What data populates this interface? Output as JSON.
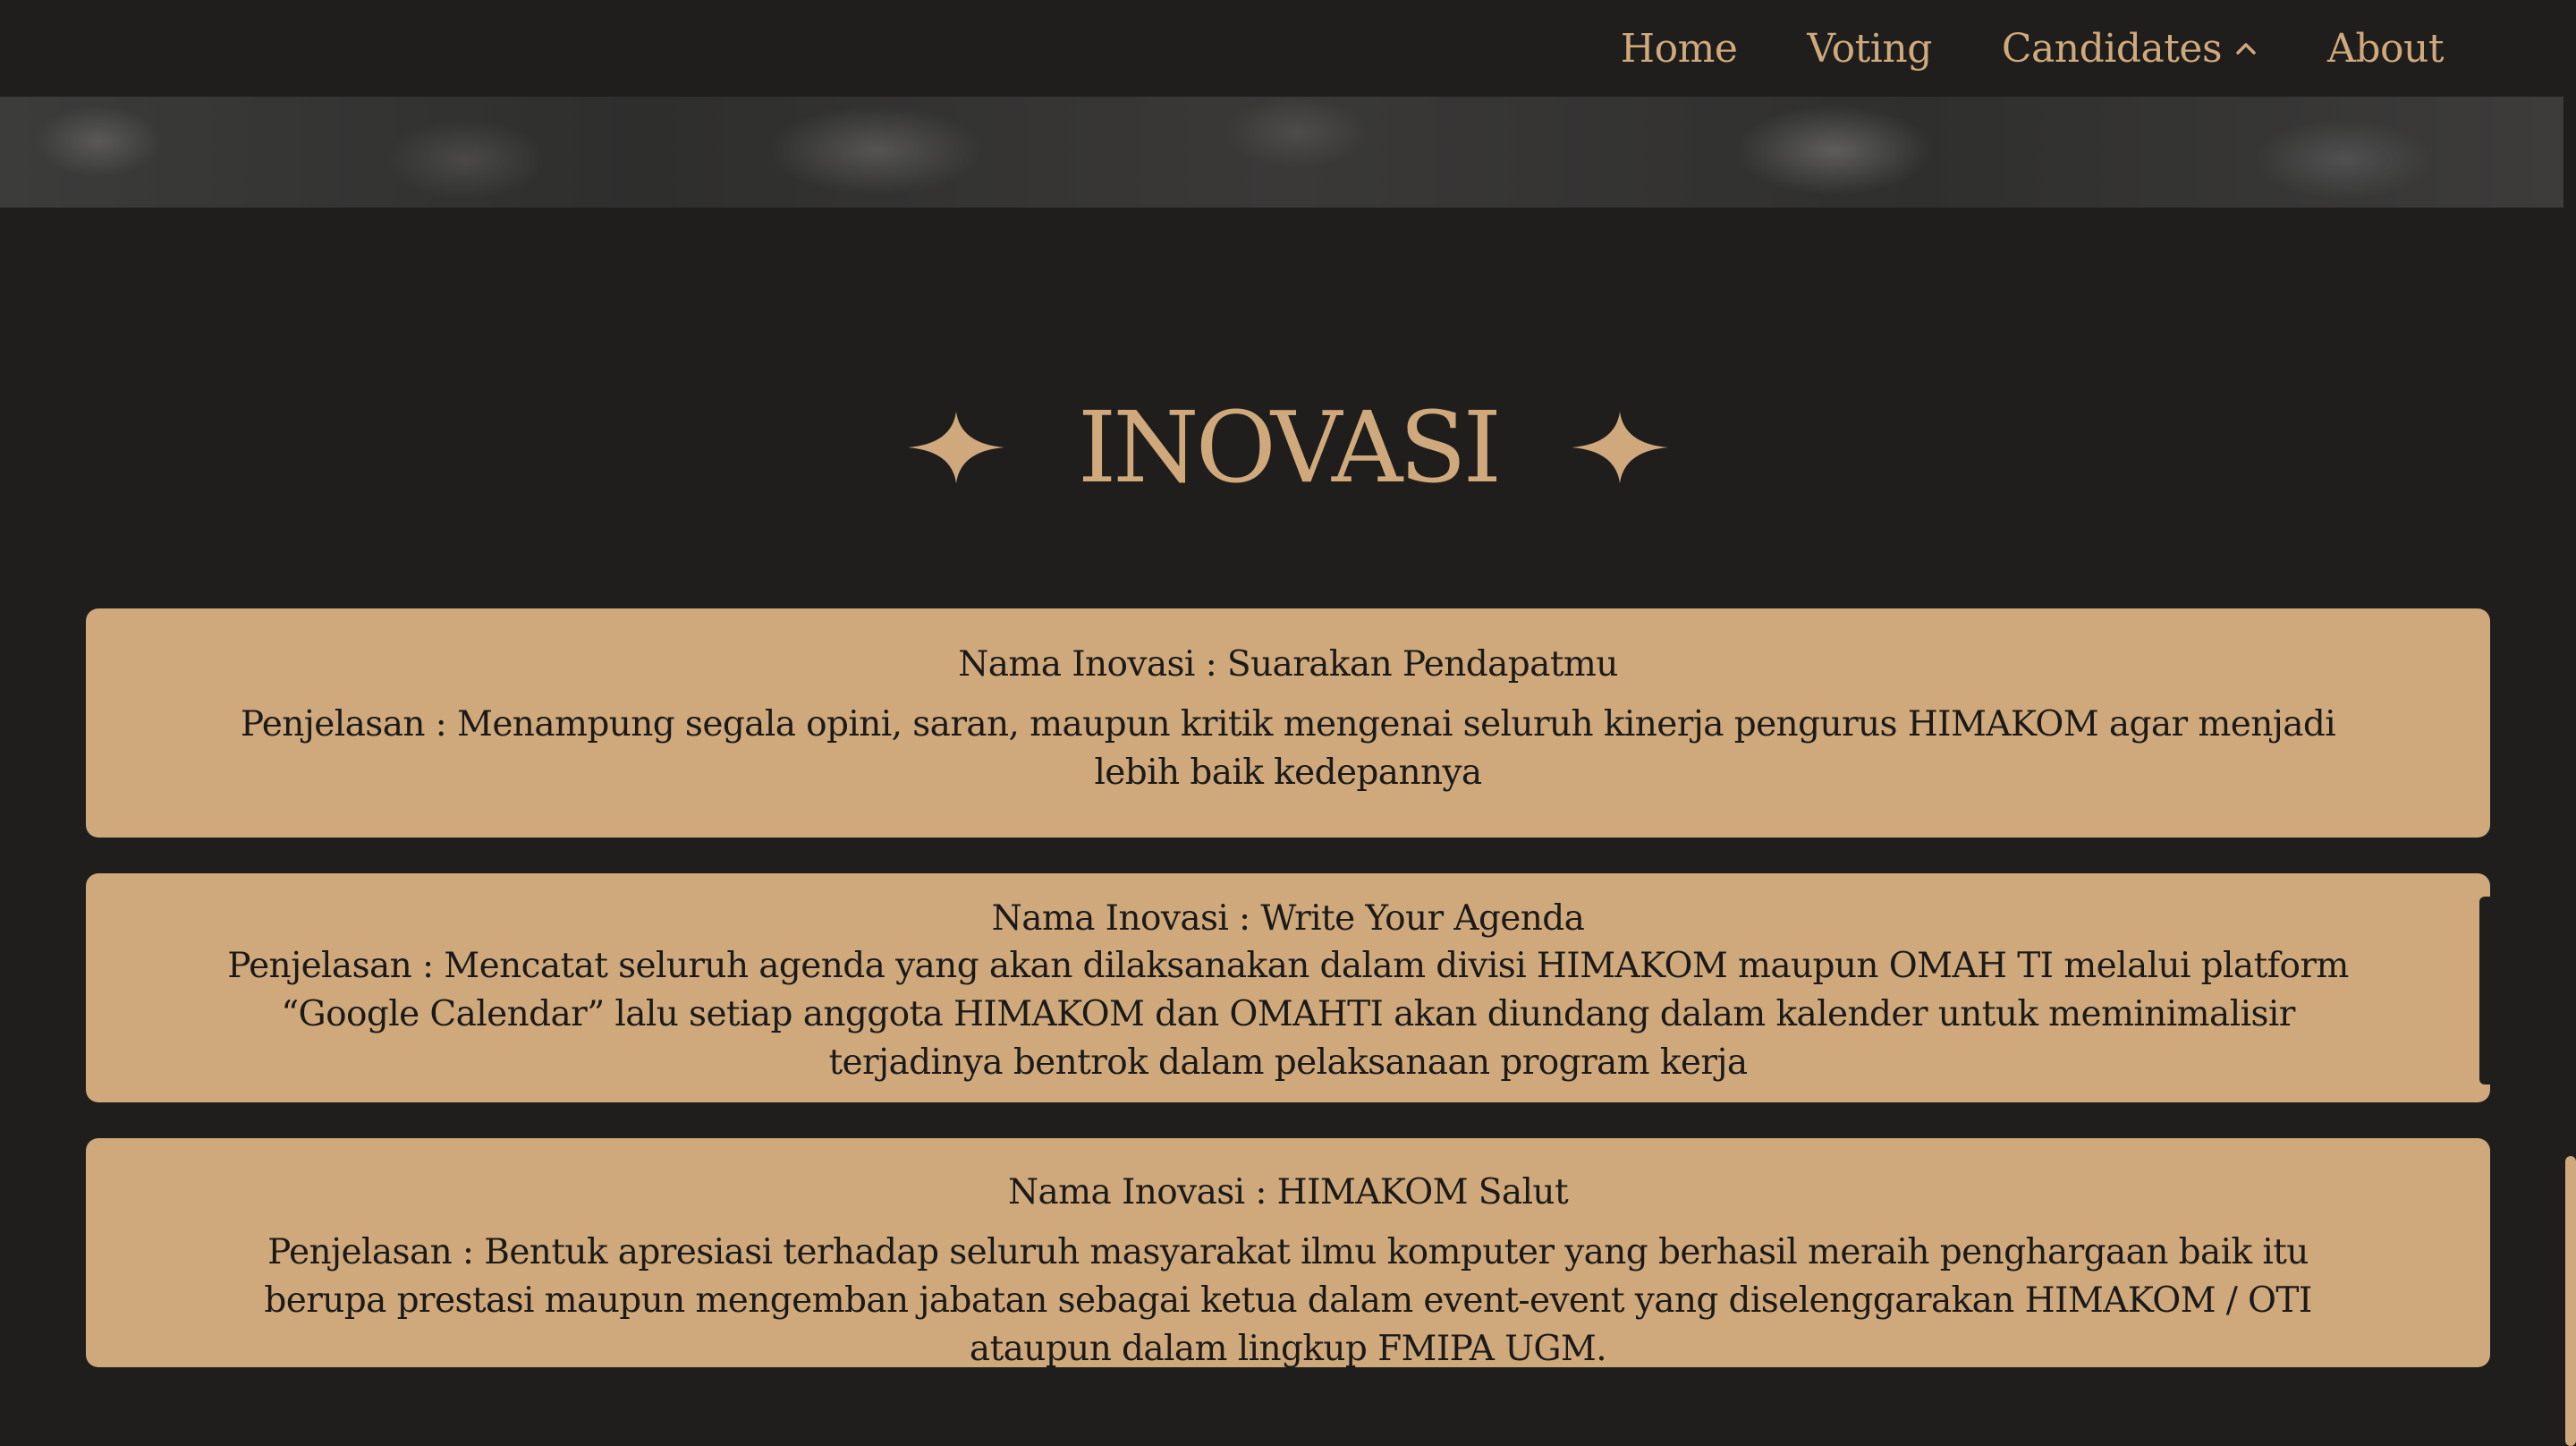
{
  "nav": {
    "items": [
      {
        "label": "Home"
      },
      {
        "label": "Voting"
      },
      {
        "label": "Candidates"
      },
      {
        "label": "About"
      }
    ]
  },
  "section": {
    "title": "INOVASI"
  },
  "innovations": [
    {
      "name": "Nama Inovasi : Suarakan Pendapatmu",
      "description": "Penjelasan : Menampung segala opini, saran, maupun kritik mengenai seluruh kinerja pengurus HIMAKOM agar menjadi lebih baik kedepannya"
    },
    {
      "name": "Nama Inovasi : Write Your Agenda",
      "description": "Penjelasan : Mencatat seluruh agenda yang akan dilaksanakan dalam divisi HIMAKOM maupun OMAH TI melalui platform “Google Calendar” lalu setiap anggota HIMAKOM dan OMAHTI akan diundang dalam kalender untuk meminimalisir terjadinya bentrok dalam pelaksanaan program kerja"
    },
    {
      "name": "Nama Inovasi : HIMAKOM Salut",
      "description": "Penjelasan : Bentuk apresiasi terhadap seluruh masyarakat ilmu komputer yang berhasil meraih penghargaan baik itu berupa prestasi maupun mengemban jabatan sebagai ketua dalam event-event yang diselenggarakan HIMAKOM / OTI ataupun dalam lingkup FMIPA UGM."
    }
  ],
  "colors": {
    "background": "#1f1e1c",
    "accent": "#cfa97c",
    "card_text": "#1b1a18"
  },
  "icons": {
    "candidates_toggle": "chevron-up-icon",
    "heading_decoration": "sparkle-icon"
  }
}
